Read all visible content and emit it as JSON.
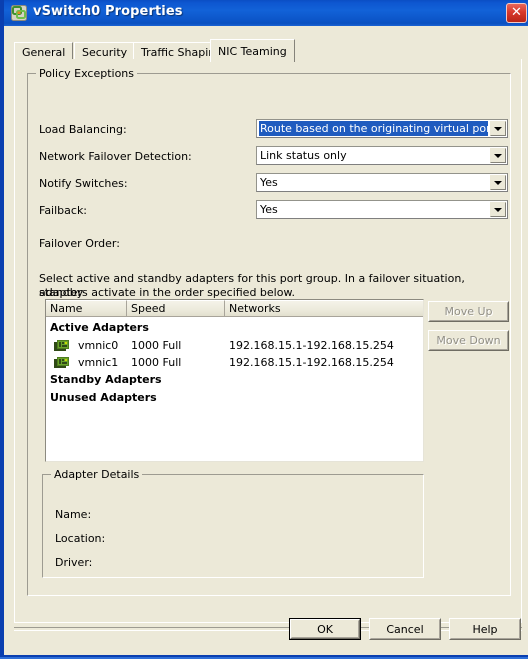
{
  "window": {
    "title": "vSwitch0 Properties",
    "icon": "vswitch-icon",
    "close_label": "✕",
    "accent_titlebar": "#0d56d0",
    "background": "#ece9d8"
  },
  "tabs": [
    {
      "label": "General",
      "active": false
    },
    {
      "label": "Security",
      "active": false
    },
    {
      "label": "Traffic Shaping",
      "active": false
    },
    {
      "label": "NIC Teaming",
      "active": true
    }
  ],
  "policy_exceptions": {
    "group_label": "Policy Exceptions",
    "fields": [
      {
        "label": "Load Balancing:",
        "value": "Route based on the originating virtual port ID",
        "focused": true
      },
      {
        "label": "Network Failover Detection:",
        "value": "Link status only",
        "focused": false
      },
      {
        "label": "Notify Switches:",
        "value": "Yes",
        "focused": false
      },
      {
        "label": "Failback:",
        "value": "Yes",
        "focused": false
      }
    ],
    "failover_order_label": "Failover Order:",
    "failover_description_line1": "Select active and standby adapters for this port group.  In a failover situation, standby",
    "failover_description_line2": "adapters activate  in the order specified below."
  },
  "adapter_list": {
    "columns": [
      "Name",
      "Speed",
      "Networks"
    ],
    "groups": [
      {
        "title": "Active Adapters",
        "rows": [
          {
            "icon": "nic-adapter-icon",
            "name": "vmnic0",
            "speed": "1000 Full",
            "networks": "192.168.15.1-192.168.15.254"
          },
          {
            "icon": "nic-adapter-icon",
            "name": "vmnic1",
            "speed": "1000 Full",
            "networks": "192.168.15.1-192.168.15.254"
          }
        ]
      },
      {
        "title": "Standby Adapters",
        "rows": []
      },
      {
        "title": "Unused Adapters",
        "rows": []
      }
    ]
  },
  "order_buttons": {
    "move_up": "Move Up",
    "move_down": "Move Down",
    "move_up_enabled": false,
    "move_down_enabled": false
  },
  "adapter_details": {
    "group_label": "Adapter Details",
    "name_label": "Name:",
    "name_value": "",
    "location_label": "Location:",
    "location_value": "",
    "driver_label": "Driver:",
    "driver_value": ""
  },
  "dialog_buttons": {
    "ok": "OK",
    "cancel": "Cancel",
    "help": "Help"
  }
}
